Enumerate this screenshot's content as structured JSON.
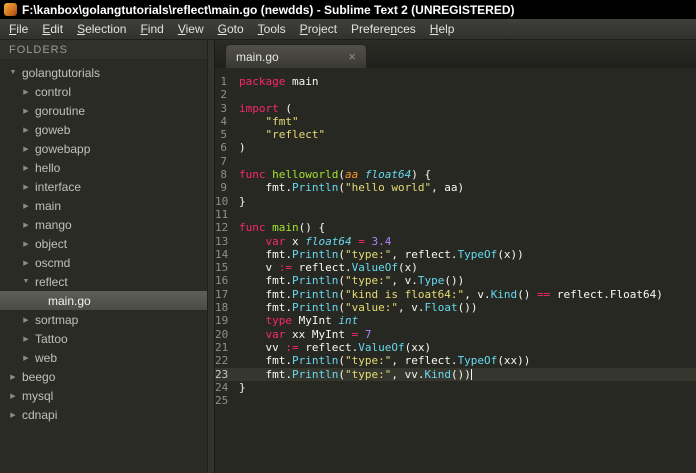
{
  "window": {
    "title": "F:\\kanbox\\golangtutorials\\reflect\\main.go (newdds) - Sublime Text 2 (UNREGISTERED)"
  },
  "menu": {
    "items": [
      {
        "label": "File",
        "underline": 0
      },
      {
        "label": "Edit",
        "underline": 0
      },
      {
        "label": "Selection",
        "underline": 0
      },
      {
        "label": "Find",
        "underline": 0
      },
      {
        "label": "View",
        "underline": 0
      },
      {
        "label": "Goto",
        "underline": 0
      },
      {
        "label": "Tools",
        "underline": 0
      },
      {
        "label": "Project",
        "underline": 0
      },
      {
        "label": "Preferences",
        "underline": 7
      },
      {
        "label": "Help",
        "underline": 0
      }
    ]
  },
  "icons": {
    "expanded": "▼",
    "collapsed": "▶",
    "tab_close": "×"
  },
  "sidebar": {
    "header": "FOLDERS",
    "items": [
      {
        "label": "golangtutorials",
        "level": 0,
        "kind": "folder",
        "expanded": true,
        "selected": false
      },
      {
        "label": "control",
        "level": 1,
        "kind": "folder",
        "expanded": false,
        "selected": false
      },
      {
        "label": "goroutine",
        "level": 1,
        "kind": "folder",
        "expanded": false,
        "selected": false
      },
      {
        "label": "goweb",
        "level": 1,
        "kind": "folder",
        "expanded": false,
        "selected": false
      },
      {
        "label": "gowebapp",
        "level": 1,
        "kind": "folder",
        "expanded": false,
        "selected": false
      },
      {
        "label": "hello",
        "level": 1,
        "kind": "folder",
        "expanded": false,
        "selected": false
      },
      {
        "label": "interface",
        "level": 1,
        "kind": "folder",
        "expanded": false,
        "selected": false
      },
      {
        "label": "main",
        "level": 1,
        "kind": "folder",
        "expanded": false,
        "selected": false
      },
      {
        "label": "mango",
        "level": 1,
        "kind": "folder",
        "expanded": false,
        "selected": false
      },
      {
        "label": "object",
        "level": 1,
        "kind": "folder",
        "expanded": false,
        "selected": false
      },
      {
        "label": "oscmd",
        "level": 1,
        "kind": "folder",
        "expanded": false,
        "selected": false
      },
      {
        "label": "reflect",
        "level": 1,
        "kind": "folder",
        "expanded": true,
        "selected": false
      },
      {
        "label": "main.go",
        "level": 2,
        "kind": "file",
        "expanded": false,
        "selected": true
      },
      {
        "label": "sortmap",
        "level": 1,
        "kind": "folder",
        "expanded": false,
        "selected": false
      },
      {
        "label": "Tattoo",
        "level": 1,
        "kind": "folder",
        "expanded": false,
        "selected": false
      },
      {
        "label": "web",
        "level": 1,
        "kind": "folder",
        "expanded": false,
        "selected": false
      },
      {
        "label": "beego",
        "level": 0,
        "kind": "folder",
        "expanded": false,
        "selected": false
      },
      {
        "label": "mysql",
        "level": 0,
        "kind": "folder",
        "expanded": false,
        "selected": false
      },
      {
        "label": "cdnapi",
        "level": 0,
        "kind": "folder",
        "expanded": false,
        "selected": false
      }
    ]
  },
  "tabs": [
    {
      "label": "main.go",
      "active": true
    }
  ],
  "editor": {
    "current_line": 23,
    "lines": [
      {
        "num": 1,
        "tokens": [
          {
            "c": "kw",
            "t": "package"
          },
          {
            "c": "pl",
            "t": " main"
          }
        ]
      },
      {
        "num": 2,
        "tokens": []
      },
      {
        "num": 3,
        "tokens": [
          {
            "c": "kw",
            "t": "import"
          },
          {
            "c": "pl",
            "t": " ("
          }
        ]
      },
      {
        "num": 4,
        "tokens": [
          {
            "c": "pl",
            "t": "    "
          },
          {
            "c": "st",
            "t": "\"fmt\""
          }
        ]
      },
      {
        "num": 5,
        "tokens": [
          {
            "c": "pl",
            "t": "    "
          },
          {
            "c": "st",
            "t": "\"reflect\""
          }
        ]
      },
      {
        "num": 6,
        "tokens": [
          {
            "c": "pl",
            "t": ")"
          }
        ]
      },
      {
        "num": 7,
        "tokens": []
      },
      {
        "num": 8,
        "tokens": [
          {
            "c": "kw",
            "t": "func"
          },
          {
            "c": "pl",
            "t": " "
          },
          {
            "c": "fnd",
            "t": "helloworld"
          },
          {
            "c": "pl",
            "t": "("
          },
          {
            "c": "pm",
            "t": "aa"
          },
          {
            "c": "pl",
            "t": " "
          },
          {
            "c": "ty",
            "t": "float64"
          },
          {
            "c": "pl",
            "t": ") {"
          }
        ]
      },
      {
        "num": 9,
        "tokens": [
          {
            "c": "pl",
            "t": "    fmt."
          },
          {
            "c": "fn",
            "t": "Println"
          },
          {
            "c": "pl",
            "t": "("
          },
          {
            "c": "st",
            "t": "\"hello world\""
          },
          {
            "c": "pl",
            "t": ", aa)"
          }
        ]
      },
      {
        "num": 10,
        "tokens": [
          {
            "c": "pl",
            "t": "}"
          }
        ]
      },
      {
        "num": 11,
        "tokens": []
      },
      {
        "num": 12,
        "tokens": [
          {
            "c": "kw",
            "t": "func"
          },
          {
            "c": "pl",
            "t": " "
          },
          {
            "c": "fnd",
            "t": "main"
          },
          {
            "c": "pl",
            "t": "() {"
          }
        ]
      },
      {
        "num": 13,
        "tokens": [
          {
            "c": "pl",
            "t": "    "
          },
          {
            "c": "kw",
            "t": "var"
          },
          {
            "c": "pl",
            "t": " x "
          },
          {
            "c": "ty",
            "t": "float64"
          },
          {
            "c": "pl",
            "t": " "
          },
          {
            "c": "kw",
            "t": "="
          },
          {
            "c": "pl",
            "t": " "
          },
          {
            "c": "nu",
            "t": "3.4"
          }
        ]
      },
      {
        "num": 14,
        "tokens": [
          {
            "c": "pl",
            "t": "    fmt."
          },
          {
            "c": "fn",
            "t": "Println"
          },
          {
            "c": "pl",
            "t": "("
          },
          {
            "c": "st",
            "t": "\"type:\""
          },
          {
            "c": "pl",
            "t": ", reflect."
          },
          {
            "c": "fn",
            "t": "TypeOf"
          },
          {
            "c": "pl",
            "t": "(x))"
          }
        ]
      },
      {
        "num": 15,
        "tokens": [
          {
            "c": "pl",
            "t": "    v "
          },
          {
            "c": "kw",
            "t": ":="
          },
          {
            "c": "pl",
            "t": " reflect."
          },
          {
            "c": "fn",
            "t": "ValueOf"
          },
          {
            "c": "pl",
            "t": "(x)"
          }
        ]
      },
      {
        "num": 16,
        "tokens": [
          {
            "c": "pl",
            "t": "    fmt."
          },
          {
            "c": "fn",
            "t": "Println"
          },
          {
            "c": "pl",
            "t": "("
          },
          {
            "c": "st",
            "t": "\"type:\""
          },
          {
            "c": "pl",
            "t": ", v."
          },
          {
            "c": "fn",
            "t": "Type"
          },
          {
            "c": "pl",
            "t": "())"
          }
        ]
      },
      {
        "num": 17,
        "tokens": [
          {
            "c": "pl",
            "t": "    fmt."
          },
          {
            "c": "fn",
            "t": "Println"
          },
          {
            "c": "pl",
            "t": "("
          },
          {
            "c": "st",
            "t": "\"kind is float64:\""
          },
          {
            "c": "pl",
            "t": ", v."
          },
          {
            "c": "fn",
            "t": "Kind"
          },
          {
            "c": "pl",
            "t": "() "
          },
          {
            "c": "kw",
            "t": "=="
          },
          {
            "c": "pl",
            "t": " reflect.Float64)"
          }
        ]
      },
      {
        "num": 18,
        "tokens": [
          {
            "c": "pl",
            "t": "    fmt."
          },
          {
            "c": "fn",
            "t": "Println"
          },
          {
            "c": "pl",
            "t": "("
          },
          {
            "c": "st",
            "t": "\"value:\""
          },
          {
            "c": "pl",
            "t": ", v."
          },
          {
            "c": "fn",
            "t": "Float"
          },
          {
            "c": "pl",
            "t": "())"
          }
        ]
      },
      {
        "num": 19,
        "tokens": [
          {
            "c": "pl",
            "t": "    "
          },
          {
            "c": "kw",
            "t": "type"
          },
          {
            "c": "pl",
            "t": " MyInt "
          },
          {
            "c": "ty",
            "t": "int"
          }
        ]
      },
      {
        "num": 20,
        "tokens": [
          {
            "c": "pl",
            "t": "    "
          },
          {
            "c": "kw",
            "t": "var"
          },
          {
            "c": "pl",
            "t": " xx MyInt "
          },
          {
            "c": "kw",
            "t": "="
          },
          {
            "c": "pl",
            "t": " "
          },
          {
            "c": "nu",
            "t": "7"
          }
        ]
      },
      {
        "num": 21,
        "tokens": [
          {
            "c": "pl",
            "t": "    vv "
          },
          {
            "c": "kw",
            "t": ":="
          },
          {
            "c": "pl",
            "t": " reflect."
          },
          {
            "c": "fn",
            "t": "ValueOf"
          },
          {
            "c": "pl",
            "t": "(xx)"
          }
        ]
      },
      {
        "num": 22,
        "tokens": [
          {
            "c": "pl",
            "t": "    fmt."
          },
          {
            "c": "fn",
            "t": "Println"
          },
          {
            "c": "pl",
            "t": "("
          },
          {
            "c": "st",
            "t": "\"type:\""
          },
          {
            "c": "pl",
            "t": ", reflect."
          },
          {
            "c": "fn",
            "t": "TypeOf"
          },
          {
            "c": "pl",
            "t": "(xx))"
          }
        ]
      },
      {
        "num": 23,
        "tokens": [
          {
            "c": "pl",
            "t": "    fmt."
          },
          {
            "c": "fn",
            "t": "Println"
          },
          {
            "c": "pl",
            "t": "("
          },
          {
            "c": "st",
            "t": "\"type:\""
          },
          {
            "c": "pl",
            "t": ", vv."
          },
          {
            "c": "fn",
            "t": "Kind"
          },
          {
            "c": "pl",
            "t": "())"
          }
        ]
      },
      {
        "num": 24,
        "tokens": [
          {
            "c": "pl",
            "t": "}"
          }
        ]
      },
      {
        "num": 25,
        "tokens": []
      }
    ]
  },
  "colors": {
    "titlebar_bg": "#000000",
    "menubar_bg": "#3a3a38",
    "sidebar_bg": "#2b2b26",
    "editor_bg": "#272822",
    "selection_bg": "#55564e",
    "current_line_bg": "#35362e",
    "keyword": "#f92672",
    "function_call": "#66d9ef",
    "function_def": "#a6e22e",
    "type_italic": "#66d9ef",
    "string": "#e6db74",
    "number": "#ae81ff",
    "parameter": "#fd971f",
    "plain_text": "#f8f8f2",
    "line_number": "#8f908a"
  }
}
